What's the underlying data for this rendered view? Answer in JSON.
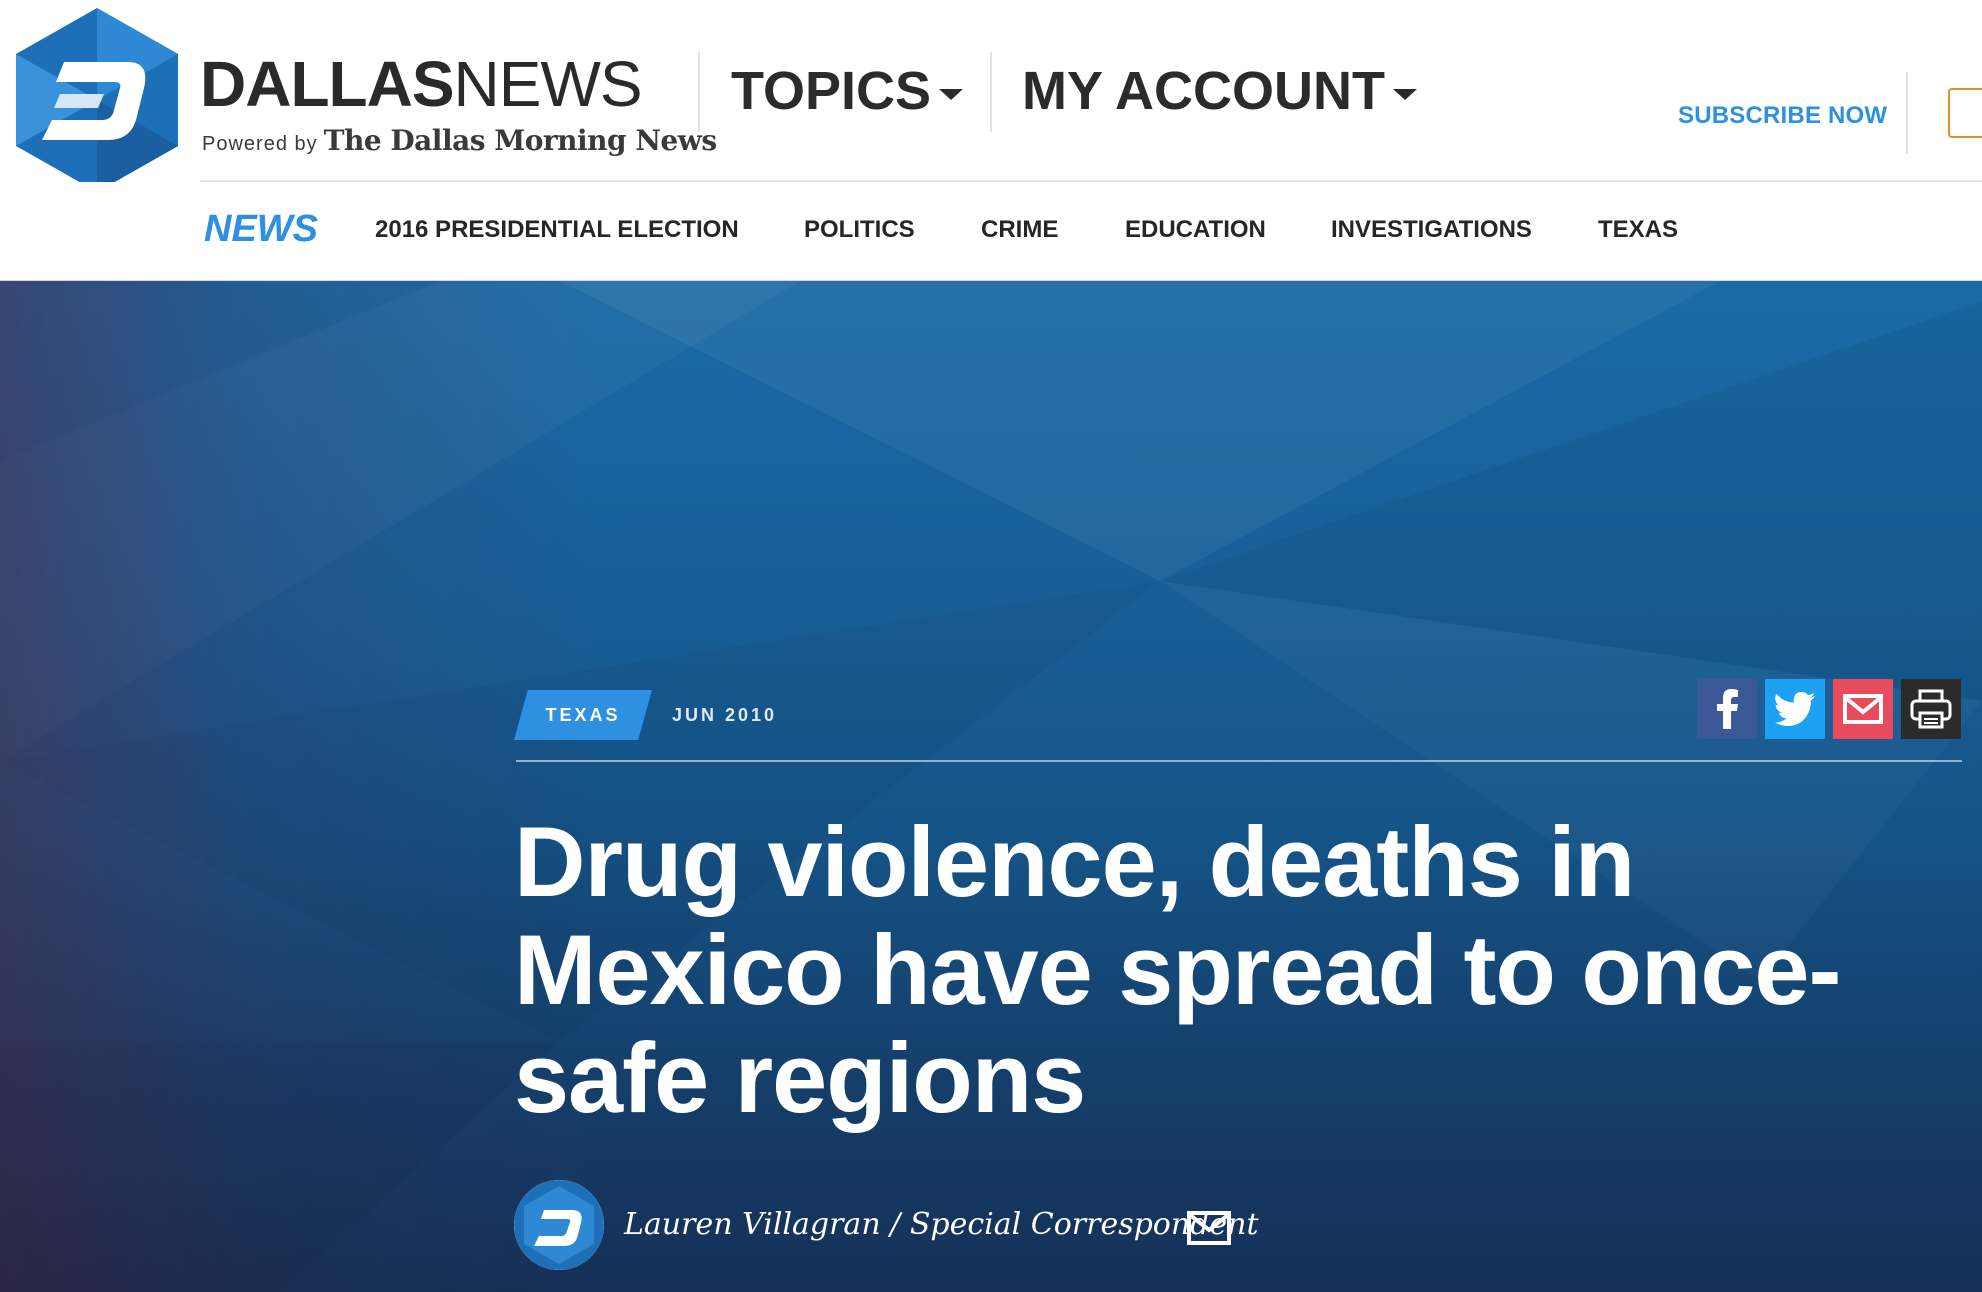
{
  "brand": {
    "name_bold": "DALLAS",
    "name_light": "NEWS",
    "powered_by": "Powered by",
    "paper": "The Dallas Morning News"
  },
  "topnav": {
    "topics": "TOPICS",
    "account": "MY ACCOUNT",
    "subscribe": "SUBSCRIBE NOW"
  },
  "section": {
    "label": "NEWS",
    "links": [
      "2016 PRESIDENTIAL ELECTION",
      "POLITICS",
      "CRIME",
      "EDUCATION",
      "INVESTIGATIONS",
      "TEXAS"
    ]
  },
  "article": {
    "category": "TEXAS",
    "date": "JUN 2010",
    "headline": "Drug violence, deaths in Mexico have spread to once-safe regions",
    "author": "Lauren Villagran / Special Correspondent"
  },
  "share": [
    {
      "icon": "facebook-icon",
      "color": "#3b5998"
    },
    {
      "icon": "twitter-icon",
      "color": "#1da1f2"
    },
    {
      "icon": "email-icon",
      "color": "#e84c5c"
    },
    {
      "icon": "print-icon",
      "color": "#2b2b2b"
    }
  ],
  "colors": {
    "accent": "#2f8fe0",
    "hero": "#175f99",
    "text_dark": "#2a2a2a"
  }
}
